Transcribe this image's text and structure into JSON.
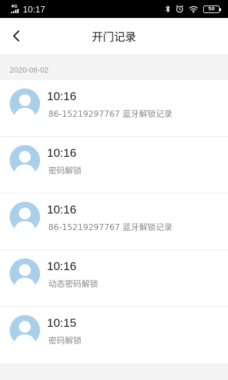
{
  "status_bar": {
    "network": "4G",
    "time": "10:17",
    "battery": "50",
    "icons": [
      "signal-icon",
      "bluetooth-icon",
      "alarm-icon",
      "wifi-icon",
      "battery-icon"
    ]
  },
  "nav": {
    "title": "开门记录",
    "back_icon": "chevron-left-icon"
  },
  "date_header": "2020-06-02",
  "records": [
    {
      "time": "10:16",
      "desc": "86-15219297767 蓝牙解锁记录"
    },
    {
      "time": "10:16",
      "desc": "密码解锁"
    },
    {
      "time": "10:16",
      "desc": "86-15219297767 蓝牙解锁记录"
    },
    {
      "time": "10:16",
      "desc": "动态密码解锁"
    },
    {
      "time": "10:15",
      "desc": "密码解锁"
    }
  ],
  "colors": {
    "avatar_bg": "#a9cfea",
    "page_bg": "#f4f4f4",
    "status_bar_bg": "#000000"
  }
}
